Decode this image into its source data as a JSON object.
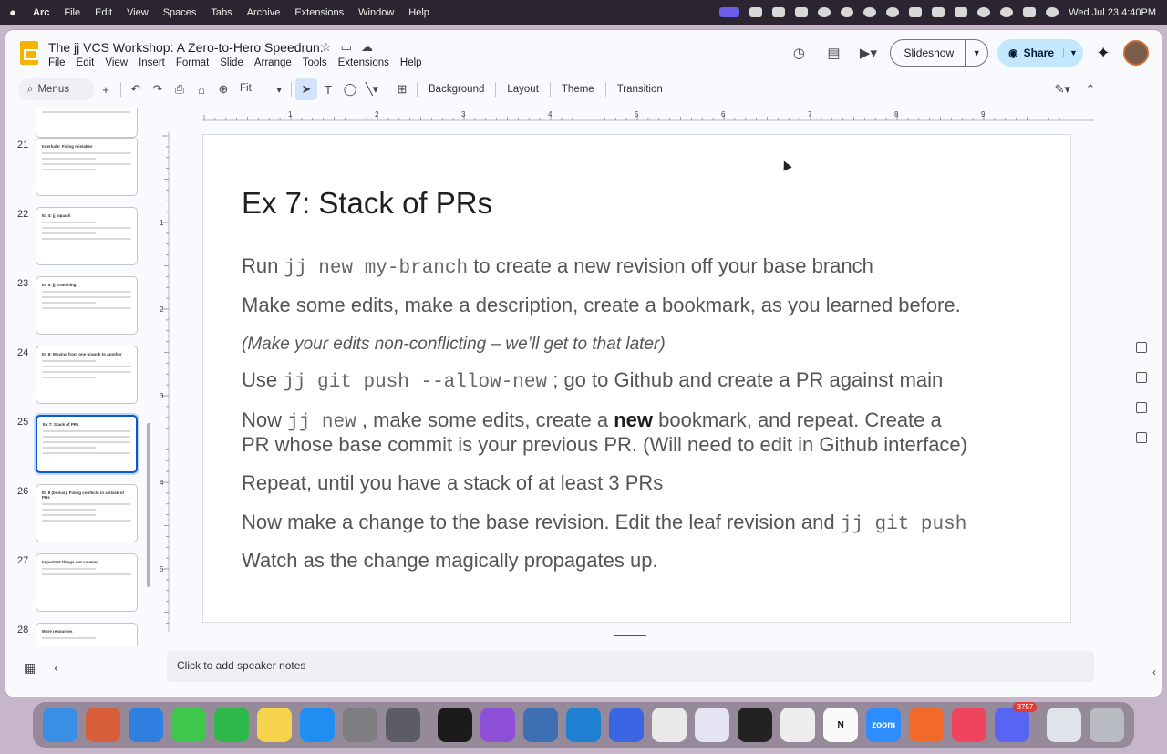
{
  "os_menubar": {
    "app": "Arc",
    "items": [
      "File",
      "Edit",
      "View",
      "Spaces",
      "Tabs",
      "Archive",
      "Extensions",
      "Window",
      "Help"
    ],
    "clock": "Wed Jul 23  4:40PM"
  },
  "doc": {
    "title": "The jj VCS Workshop: A Zero-to-Hero Speedrun:",
    "menu": [
      "File",
      "Edit",
      "View",
      "Insert",
      "Format",
      "Slide",
      "Arrange",
      "Tools",
      "Extensions",
      "Help"
    ]
  },
  "header": {
    "slideshow_label": "Slideshow",
    "share_label": "Share"
  },
  "toolbar": {
    "menus_label": "Menus",
    "zoom_value": "Fit",
    "background_label": "Background",
    "layout_label": "Layout",
    "theme_label": "Theme",
    "transition_label": "Transition"
  },
  "filmstrip": {
    "slides": [
      {
        "num": "21",
        "title": "Interlude: Fixing mistakes"
      },
      {
        "num": "22",
        "title": "Ex 4: jj squash"
      },
      {
        "num": "23",
        "title": "Ex 5: jj branching"
      },
      {
        "num": "24",
        "title": "Ex 6: Moving from one branch to another"
      },
      {
        "num": "25",
        "title": "Ex 7: Stack of PRs"
      },
      {
        "num": "26",
        "title": "Ex 8 (bonus): Fixing conflicts in a stack of PRs"
      },
      {
        "num": "27",
        "title": "Important things not covered"
      },
      {
        "num": "28",
        "title": "More resources"
      }
    ],
    "selected_index": 4
  },
  "ruler": {
    "horizontal": [
      "1",
      "2",
      "3",
      "4",
      "5",
      "6",
      "7",
      "8",
      "9"
    ],
    "vertical": [
      "1",
      "2",
      "3",
      "4",
      "5"
    ]
  },
  "slide": {
    "title": "Ex 7: Stack of PRs",
    "b1_pre": "Run ",
    "b1_code": "jj new my-branch",
    "b1_post": " to create a new revision off your base branch",
    "b2": "Make some edits, make a description, create a bookmark, as you learned before.",
    "b3": "(Make your edits non-conflicting – we’ll get to that later)",
    "b4_pre": "Use ",
    "b4_code": "jj git push --allow-new",
    "b4_post": " ; go to Github and create a PR against main",
    "b5_pre": "Now ",
    "b5_code": "jj new",
    "b5_mid": " , make some edits, create a ",
    "b5_bold": "new",
    "b5_post": " bookmark, and repeat. Create a",
    "b5_line2": "PR whose base commit is your previous PR. (Will need to edit in Github interface)",
    "b6": "Repeat, until you have a stack of at least 3 PRs",
    "b7_pre": "Now make a change to the base revision. Edit the leaf revision and ",
    "b7_code": "jj git push",
    "b8": "Watch as the change magically propagates up."
  },
  "notes": {
    "placeholder": "Click to add speaker notes"
  },
  "dock": {
    "apps": [
      "Finder",
      "Launchpad",
      "Safari",
      "Messages",
      "FaceTime",
      "Notes",
      "App Store",
      "System Settings",
      "Stacks",
      "Cursor",
      "Arc",
      "Proxyman",
      "VS Code",
      "Signal",
      "Chrome",
      "Affinity",
      "Terminal",
      "TextEdit",
      "Notion",
      "Zoom",
      "Brave",
      "Music",
      "Discord",
      "Archive",
      "Trash"
    ],
    "discord_badge": "3757",
    "zoom_label": "zoom"
  }
}
